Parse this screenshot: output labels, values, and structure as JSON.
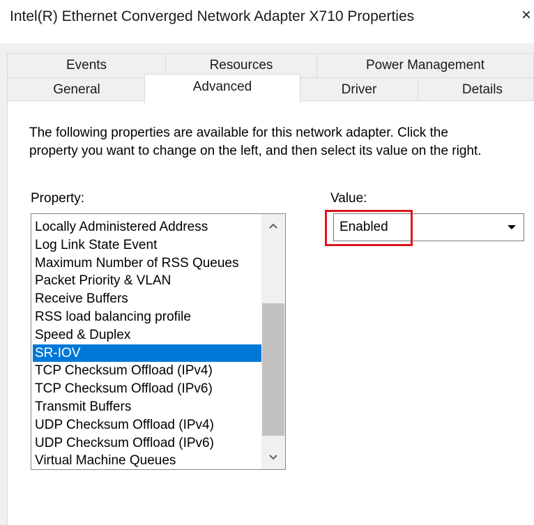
{
  "window": {
    "title": "Intel(R) Ethernet Converged Network Adapter X710 Properties",
    "close_glyph": "×"
  },
  "tabs": {
    "row1": [
      "Events",
      "Resources",
      "Power Management"
    ],
    "row2": [
      "General",
      "Advanced",
      "Driver",
      "Details"
    ],
    "active": "Advanced"
  },
  "advanced": {
    "description": "The following properties are available for this network adapter. Click the property you want to change on the left, and then select its value on the right.",
    "property_label": "Property:",
    "value_label": "Value:",
    "properties": [
      "Locally Administered Address",
      "Log Link State Event",
      "Maximum Number of RSS Queues",
      "Packet Priority & VLAN",
      "Receive Buffers",
      "RSS load balancing profile",
      "Speed & Duplex",
      "SR-IOV",
      "TCP Checksum Offload (IPv4)",
      "TCP Checksum Offload (IPv6)",
      "Transmit Buffers",
      "UDP Checksum Offload (IPv4)",
      "UDP Checksum Offload (IPv6)",
      "Virtual Machine Queues"
    ],
    "selected_property": "SR-IOV",
    "value_selected": "Enabled"
  },
  "colors": {
    "selection": "#0078d7",
    "highlight_box": "#e0141e"
  }
}
